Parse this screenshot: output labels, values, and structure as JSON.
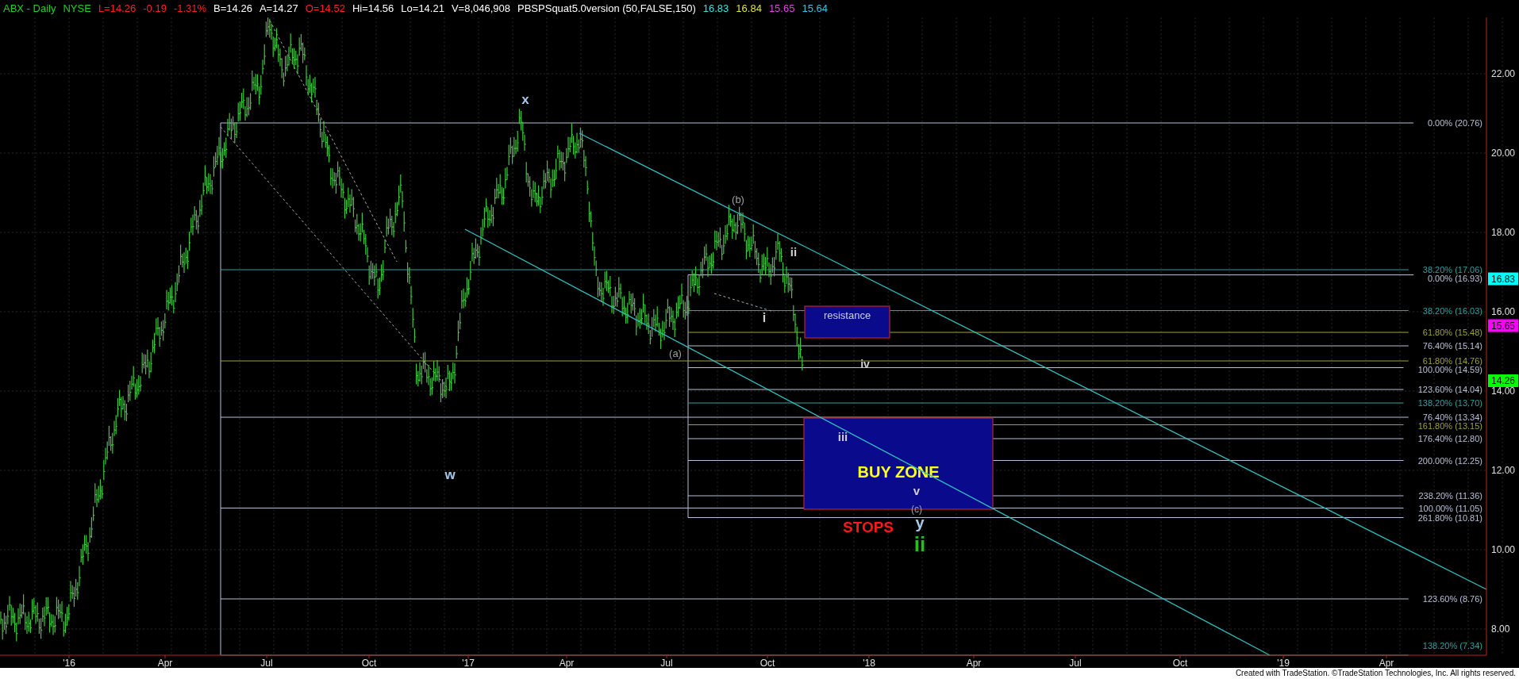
{
  "header": [
    {
      "text": "ABX - Daily",
      "color": "#20d020"
    },
    {
      "text": "NYSE",
      "color": "#20d020"
    },
    {
      "text": "L=14.26",
      "color": "#ff2020"
    },
    {
      "text": "-0.19",
      "color": "#ff2020"
    },
    {
      "text": "-1.31%",
      "color": "#ff2020"
    },
    {
      "text": "B=14.26",
      "color": "#ffffff"
    },
    {
      "text": "A=14.27",
      "color": "#ffffff"
    },
    {
      "text": "O=14.52",
      "color": "#ff2020"
    },
    {
      "text": "Hi=14.56",
      "color": "#ffffff"
    },
    {
      "text": "Lo=14.21",
      "color": "#ffffff"
    },
    {
      "text": "V=8,046,908",
      "color": "#ffffff"
    },
    {
      "text": "PBSPSquat5.0version (50,FALSE,150)",
      "color": "#ffffff"
    },
    {
      "text": "16.83",
      "color": "#40e0e0"
    },
    {
      "text": "16.84",
      "color": "#e0e040"
    },
    {
      "text": "15.65",
      "color": "#e040e0"
    },
    {
      "text": "15.64",
      "color": "#40c0e0"
    }
  ],
  "price_axis": [
    "22.00",
    "20.00",
    "18.00",
    "16.00",
    "14.00",
    "12.00",
    "10.00",
    "8.00"
  ],
  "time_axis": [
    "'16",
    "Apr",
    "Jul",
    "Oct",
    "'17",
    "Apr",
    "Jul",
    "Oct",
    "'18",
    "Apr",
    "Jul",
    "Oct",
    "'19",
    "Apr"
  ],
  "fib_levels": [
    {
      "label": "0.00% (20.76)",
      "color": "#b8c0d8"
    },
    {
      "label": "38.20% (17.06)",
      "color": "#2fa0a0"
    },
    {
      "label": "0.00% (16.93)",
      "color": "#b8c0d8"
    },
    {
      "label": "38.20% (16.03)",
      "color": "#2fa0a0"
    },
    {
      "label": "61.80% (15.48)",
      "color": "#a0a040"
    },
    {
      "label": "76.40% (15.14)",
      "color": "#b8c0d8"
    },
    {
      "label": "61.80% (14.76)",
      "color": "#a0a040"
    },
    {
      "label": "100.00% (14.59)",
      "color": "#b8c0d8"
    },
    {
      "label": "123.60% (14.04)",
      "color": "#b8c0d8"
    },
    {
      "label": "138.20% (13.70)",
      "color": "#2fa0a0"
    },
    {
      "label": "76.40% (13.34)",
      "color": "#b8c0d8"
    },
    {
      "label": "161.80% (13.15)",
      "color": "#a0a040"
    },
    {
      "label": "176.40% (12.80)",
      "color": "#b8c0d8"
    },
    {
      "label": "200.00% (12.25)",
      "color": "#b8c0d8"
    },
    {
      "label": "238.20% (11.36)",
      "color": "#b8c0d8"
    },
    {
      "label": "100.00% (11.05)",
      "color": "#b8c0d8"
    },
    {
      "label": "261.80% (10.81)",
      "color": "#b8c0d8"
    },
    {
      "label": "123.60% (8.76)",
      "color": "#b8c0d8"
    },
    {
      "label": "138.20% (7.34)",
      "color": "#2fa0a0"
    }
  ],
  "wave_labels": [
    {
      "text": "x",
      "color": "#a8c8e8"
    },
    {
      "text": "w",
      "color": "#a8c8e8"
    },
    {
      "text": "(b)",
      "color": "#a0a0a0"
    },
    {
      "text": "ii",
      "color": "#d0d0d0"
    },
    {
      "text": "i",
      "color": "#d0d0d0"
    },
    {
      "text": "(a)",
      "color": "#a0a0a0"
    },
    {
      "text": "iv",
      "color": "#d0d0d0"
    },
    {
      "text": "iii",
      "color": "#d0d0d0"
    },
    {
      "text": "v",
      "color": "#d0d0d0"
    },
    {
      "text": "(c)",
      "color": "#a0a0a0"
    },
    {
      "text": "y",
      "color": "#a8c8e8"
    },
    {
      "text": "ii",
      "color": "#20c020"
    }
  ],
  "zones": [
    {
      "kind": "resistance",
      "label": "resistance"
    },
    {
      "kind": "buy",
      "label": "BUY ZONE"
    }
  ],
  "stops_label": "STOPS",
  "price_markers": [
    {
      "text": "16.83",
      "color": "#00ffff"
    },
    {
      "text": "15.65",
      "color": "#ff00ff"
    },
    {
      "text": "14.26",
      "color": "#00ff00"
    }
  ],
  "footer": "Created with TradeStation. ©TradeStation Technologies, Inc. All rights reserved."
}
